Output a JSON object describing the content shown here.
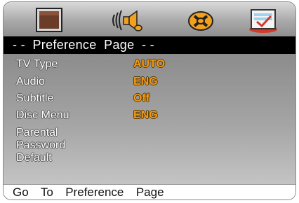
{
  "tabs": [
    {
      "icon": "general-setup-icon"
    },
    {
      "icon": "audio-speaker-icon"
    },
    {
      "icon": "dolby-digital-icon"
    },
    {
      "icon": "preference-check-icon"
    }
  ],
  "header": {
    "title": "- -  Preference  Page  - -"
  },
  "settings": [
    {
      "label": "TV Type",
      "value": "AUTO"
    },
    {
      "label": "Audio",
      "value": "ENG"
    },
    {
      "label": "Subtitle",
      "value": "Off"
    },
    {
      "label": "Disc Menu",
      "value": "ENG"
    },
    {
      "label": "Parental",
      "value": ""
    },
    {
      "label": "Password",
      "value": ""
    },
    {
      "label": "Default",
      "value": ""
    }
  ],
  "footer": {
    "help": "Go  To  Preference  Page"
  },
  "colors": {
    "value": "#f09a1a",
    "accent_selected_tab": "#3a3a3a"
  }
}
